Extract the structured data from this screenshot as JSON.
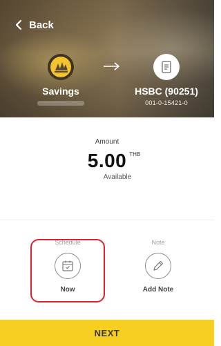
{
  "nav": {
    "back_label": "Back"
  },
  "from_account": {
    "name": "Savings"
  },
  "to_account": {
    "name": "HSBC (90251)",
    "number": "001-0-15421-0"
  },
  "amount": {
    "label": "Amount",
    "value": "5.00",
    "currency": "THB",
    "status": "Available"
  },
  "options": {
    "schedule": {
      "title": "Schedule",
      "label": "Now"
    },
    "note": {
      "title": "Note",
      "label": "Add Note"
    }
  },
  "next_button": {
    "label": "NEXT"
  },
  "colors": {
    "accent": "#f7cf21",
    "highlight": "#e0202a",
    "logo_gold": "#f4c430"
  }
}
